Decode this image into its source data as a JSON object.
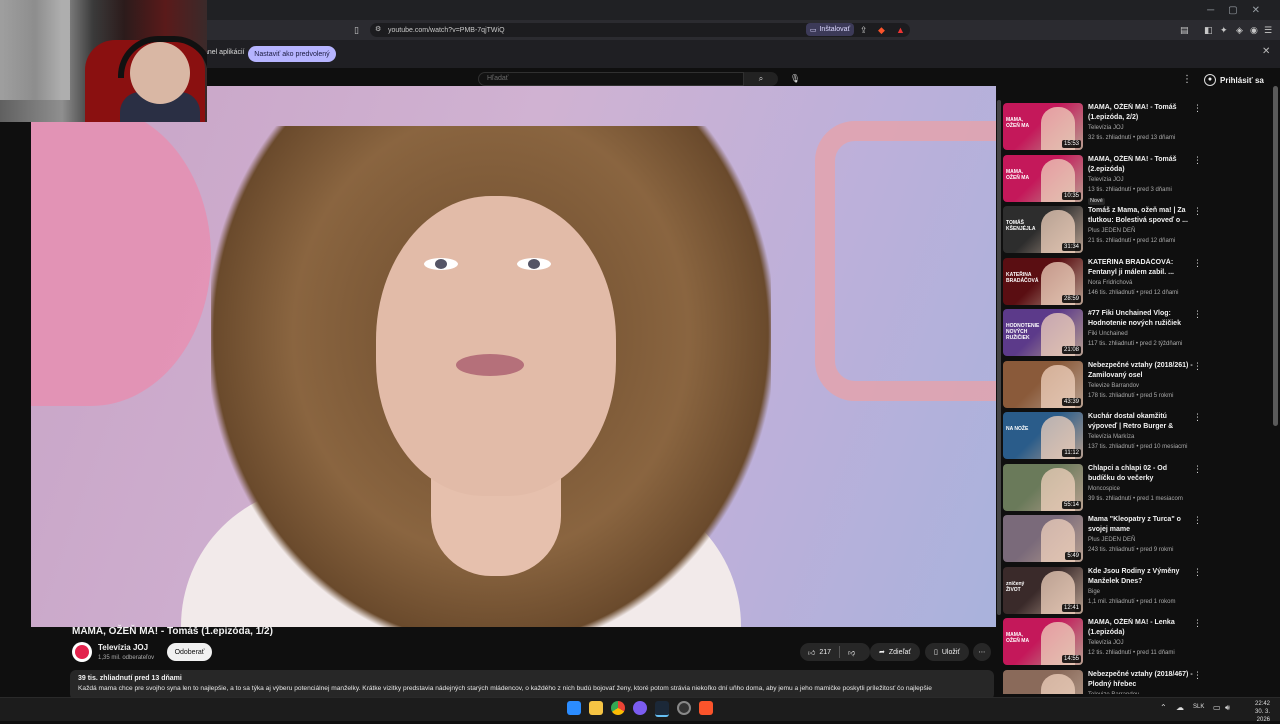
{
  "browser": {
    "url": "youtube.com/watch?v=PMB-7qjTWiQ",
    "install_label": "Inštalovať",
    "infobar_text": "anel aplikácií",
    "set_default_label": "Nastaviť ako predvolený"
  },
  "header": {
    "search_placeholder": "Hľadať",
    "signin_label": "Prihlásiť sa"
  },
  "video": {
    "title": "MAMA, OŽEŇ MA! - Tomáš (1.epizóda, 1/2)",
    "channel": "Televízia JOJ",
    "subscribers": "1,35 mil. odberateľov",
    "subscribe_label": "Odoberať",
    "likes": "217",
    "share_label": "Zdieľať",
    "save_label": "Uložiť",
    "meta": "39 tis. zhliadnutí  pred 13 dňami",
    "description": "Každá mama chce pre svojho syna len to najlepšie, a to sa týka aj výberu potenciálnej manželky. Krátke vizitky predstavia nádejných starých mládencov, o každého z nich budú bojovať ženy, ktoré potom strávia niekoľko dní uňho doma, aby jemu a jeho mamičke poskytli príležitosť čo najlepšie"
  },
  "sidebar": {
    "items": [
      {
        "title": "MAMA, OŽEŇ MA! - Tomáš (1.epizóda, 2/2)",
        "channel": "Televízia JOJ",
        "meta": "32 tis. zhliadnutí • pred 13 dňami",
        "duration": "15:53",
        "thumb_text": "MAMA, OŽEŇ MA",
        "thumb_color": "#c4185a",
        "badge": ""
      },
      {
        "title": "MAMA, OŽEŇ MA! - Tomáš (2.epizóda)",
        "channel": "Televízia JOJ",
        "meta": "13 tis. zhliadnutí • pred 3 dňami",
        "duration": "10:35",
        "thumb_text": "MAMA, OŽEŇ MA",
        "thumb_color": "#c4185a",
        "badge": "Nové"
      },
      {
        "title": "Tomáš z Mama, ožeň ma! | Za tlutkou: Bolestivá spoveď o ...",
        "channel": "Plus JEDEN DEŇ",
        "meta": "21 tis. zhliadnutí • pred 12 dňami",
        "duration": "31:34",
        "thumb_text": "TOMÁŠ KŠENJĖJLA",
        "thumb_color": "#2d2d2d",
        "badge": ""
      },
      {
        "title": "KATEŘINA BRADÁČOVÁ: Fentanyl ji málem zabil. ...",
        "channel": "Nora Fridrichová",
        "meta": "146 tis. zhliadnutí • pred 12 dňami",
        "duration": "28:59",
        "thumb_text": "KATEŘINA BRADÁČOVÁ",
        "thumb_color": "#5a0e12",
        "badge": ""
      },
      {
        "title": "#77 Fiki Unchained Vlog: Hodnotenie nových ružičiek",
        "channel": "Fiki Unchained",
        "meta": "117 tis. zhliadnutí • pred 2 týždňami",
        "duration": "21:08",
        "thumb_text": "HODNOTENIE NOVÝCH RUŽIČIEK",
        "thumb_color": "#5c3a8a",
        "badge": ""
      },
      {
        "title": "Nebezpečné vztahy (2018/261) - Zamilovaný osel",
        "channel": "Televize Barrandov",
        "meta": "178 tis. zhliadnutí • pred 5 rokmi",
        "duration": "43:39",
        "thumb_text": "",
        "thumb_color": "#8a5a3a",
        "badge": ""
      },
      {
        "title": "Kuchár dostal okamžitú výpoveď | Retro Burger & Dinn...",
        "channel": "Televízia Markíza",
        "meta": "137 tis. zhliadnutí • pred 10 mesiacmi",
        "duration": "11:12",
        "thumb_text": "NA NOŽE",
        "thumb_color": "#2a5c8a",
        "badge": ""
      },
      {
        "title": "Chlapci a chlapi 02 - Od budíčku do večerky",
        "channel": "Moncospice",
        "meta": "39 tis. zhliadnutí • pred 1 mesiacom",
        "duration": "55:14",
        "thumb_text": "",
        "thumb_color": "#6a7a5a",
        "badge": ""
      },
      {
        "title": "Mama \"Kleopatry z Turca\" o svojej mame",
        "channel": "Plus JEDEN DEŇ",
        "meta": "243 tis. zhliadnutí • pred 9 rokmi",
        "duration": "5:49",
        "thumb_text": "",
        "thumb_color": "#7a6a7a",
        "badge": ""
      },
      {
        "title": "Kde Jsou Rodiny z Výměny Manželek Dnes?",
        "channel": "Bige",
        "meta": "1,1 mil. zhliadnutí • pred 1 rokom",
        "duration": "12:41",
        "thumb_text": "zničený ŽIVOT",
        "thumb_color": "#3a2a2a",
        "badge": ""
      },
      {
        "title": "MAMA, OŽEŇ MA! - Lenka (1.epizóda)",
        "channel": "Televízia JOJ",
        "meta": "12 tis. zhliadnutí • pred 11 dňami",
        "duration": "14:55",
        "thumb_text": "MAMA, OŽEŇ MA",
        "thumb_color": "#c4185a",
        "badge": ""
      },
      {
        "title": "Nebezpečné vztahy (2018/467) - Plodný hřebec",
        "channel": "Televize Barrandov",
        "meta": "",
        "duration": "",
        "thumb_text": "",
        "thumb_color": "#8a6a5a",
        "badge": ""
      }
    ]
  },
  "taskbar": {
    "language": "SLK",
    "time": "22:42",
    "date": "30. 3. 2026"
  }
}
